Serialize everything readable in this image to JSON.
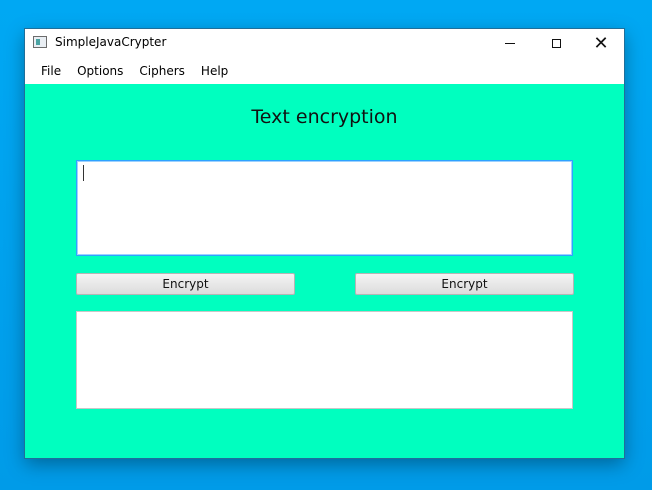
{
  "window": {
    "title": "SimpleJavaCrypter",
    "controls": {
      "minimize": "minimize",
      "maximize": "maximize",
      "close": "close"
    }
  },
  "menu": {
    "items": [
      {
        "label": "File"
      },
      {
        "label": "Options"
      },
      {
        "label": "Ciphers"
      },
      {
        "label": "Help"
      }
    ]
  },
  "main": {
    "heading": "Text encryption",
    "input_value": "",
    "left_button_label": "Encrypt",
    "right_button_label": "Encrypt",
    "output_value": ""
  },
  "colors": {
    "desktop": "#00a2ed",
    "window_background": "#00ffbf",
    "input_focus_border": "#2fa2ff"
  }
}
